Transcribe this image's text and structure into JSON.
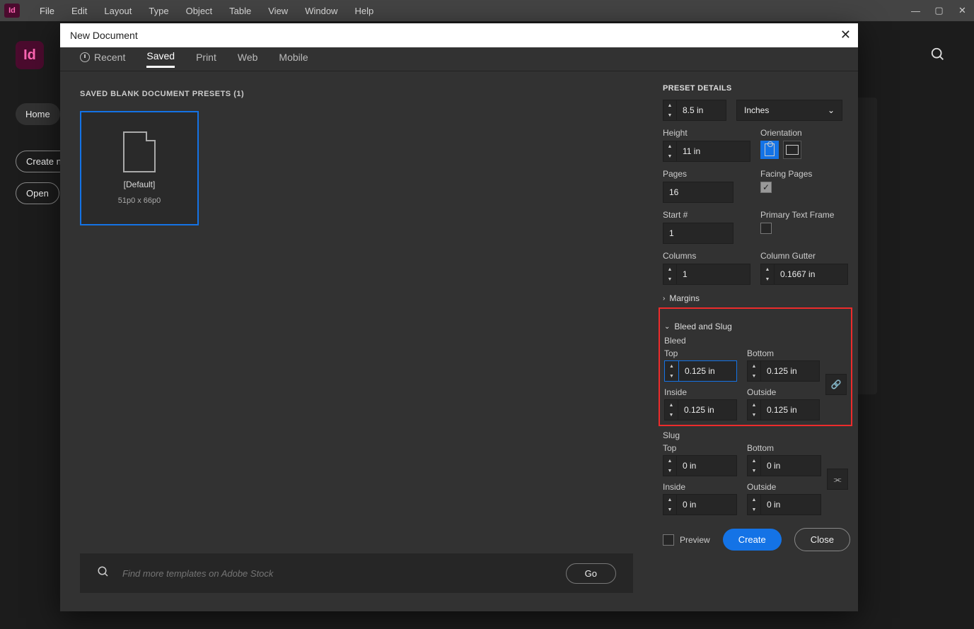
{
  "menubar": {
    "logo": "Id",
    "items": [
      "File",
      "Edit",
      "Layout",
      "Type",
      "Object",
      "Table",
      "View",
      "Window",
      "Help"
    ]
  },
  "leftRail": {
    "id": "Id",
    "home": "Home",
    "createNew": "Create new",
    "open": "Open"
  },
  "dialog": {
    "title": "New Document",
    "tabs": {
      "recent": "Recent",
      "saved": "Saved",
      "print": "Print",
      "web": "Web",
      "mobile": "Mobile"
    },
    "sectionHead": "SAVED BLANK DOCUMENT PRESETS (1)",
    "preset": {
      "name": "[Default]",
      "dim": "51p0 x 66p0"
    },
    "search": {
      "placeholder": "Find more templates on Adobe Stock",
      "go": "Go"
    }
  },
  "panel": {
    "head": "PRESET DETAILS",
    "width": "8.5 in",
    "units": "Inches",
    "heightLbl": "Height",
    "height": "11 in",
    "orientLbl": "Orientation",
    "pagesLbl": "Pages",
    "pages": "16",
    "facingLbl": "Facing Pages",
    "startLbl": "Start #",
    "start": "1",
    "ptfLbl": "Primary Text Frame",
    "colsLbl": "Columns",
    "cols": "1",
    "gutterLbl": "Column Gutter",
    "gutter": "0.1667 in",
    "margins": "Margins",
    "bleedSlug": "Bleed and Slug",
    "bleedLbl": "Bleed",
    "topLbl": "Top",
    "bottomLbl": "Bottom",
    "insideLbl": "Inside",
    "outsideLbl": "Outside",
    "bleed": {
      "top": "0.125 in",
      "bottom": "0.125 in",
      "inside": "0.125 in",
      "outside": "0.125 in"
    },
    "slugLbl": "Slug",
    "slug": {
      "top": "0 in",
      "bottom": "0 in",
      "inside": "0 in",
      "outside": "0 in"
    },
    "preview": "Preview",
    "create": "Create",
    "close": "Close"
  }
}
